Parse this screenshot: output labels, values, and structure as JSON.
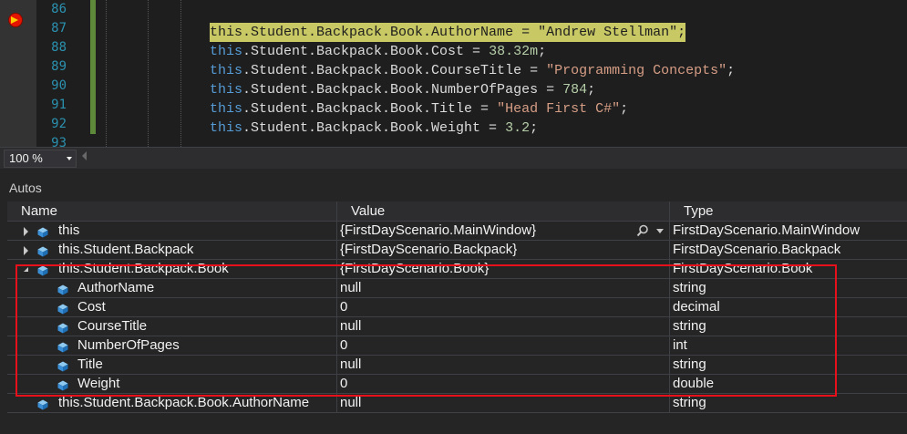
{
  "editor": {
    "line_numbers": [
      "86",
      "87",
      "88",
      "89",
      "90",
      "91",
      "92",
      "93"
    ],
    "lines": [
      {
        "kw": "",
        "rest": "",
        "value": "",
        "value_kind": "",
        "end": ""
      },
      {
        "kw": "this",
        "rest": ".Student.Backpack.Book.AuthorName = ",
        "value": "\"Andrew Stellman\"",
        "value_kind": "str",
        "end": ";"
      },
      {
        "kw": "this",
        "rest": ".Student.Backpack.Book.Cost = ",
        "value": "38.32m",
        "value_kind": "num",
        "end": ";"
      },
      {
        "kw": "this",
        "rest": ".Student.Backpack.Book.CourseTitle = ",
        "value": "\"Programming Concepts\"",
        "value_kind": "str",
        "end": ";"
      },
      {
        "kw": "this",
        "rest": ".Student.Backpack.Book.NumberOfPages = ",
        "value": "784",
        "value_kind": "num",
        "end": ";"
      },
      {
        "kw": "this",
        "rest": ".Student.Backpack.Book.Title = ",
        "value": "\"Head First C#\"",
        "value_kind": "str",
        "end": ";"
      },
      {
        "kw": "this",
        "rest": ".Student.Backpack.Book.Weight = ",
        "value": "3.2",
        "value_kind": "num",
        "end": ";"
      },
      {
        "kw": "",
        "rest": "",
        "value": "",
        "value_kind": "",
        "end": ""
      }
    ],
    "current_line": "87"
  },
  "zoom": {
    "value": "100 %"
  },
  "autos": {
    "title": "Autos",
    "columns": {
      "name": "Name",
      "value": "Value",
      "type": "Type"
    },
    "rows": [
      {
        "indent": 0,
        "expander": "collapsed",
        "name": "this",
        "value": "{FirstDayScenario.MainWindow}",
        "type": "FirstDayScenario.MainWindow",
        "search": true
      },
      {
        "indent": 0,
        "expander": "collapsed",
        "name": "this.Student.Backpack",
        "value": "{FirstDayScenario.Backpack}",
        "type": "FirstDayScenario.Backpack",
        "search": false
      },
      {
        "indent": 0,
        "expander": "expanded",
        "name": "this.Student.Backpack.Book",
        "value": "{FirstDayScenario.Book}",
        "type": "FirstDayScenario.Book",
        "search": false
      },
      {
        "indent": 1,
        "expander": "none",
        "name": "AuthorName",
        "value": "null",
        "type": "string",
        "search": false
      },
      {
        "indent": 1,
        "expander": "none",
        "name": "Cost",
        "value": "0",
        "type": "decimal",
        "search": false
      },
      {
        "indent": 1,
        "expander": "none",
        "name": "CourseTitle",
        "value": "null",
        "type": "string",
        "search": false
      },
      {
        "indent": 1,
        "expander": "none",
        "name": "NumberOfPages",
        "value": "0",
        "type": "int",
        "search": false
      },
      {
        "indent": 1,
        "expander": "none",
        "name": "Title",
        "value": "null",
        "type": "string",
        "search": false
      },
      {
        "indent": 1,
        "expander": "none",
        "name": "Weight",
        "value": "0",
        "type": "double",
        "search": false
      },
      {
        "indent": 0,
        "expander": "none",
        "name": "this.Student.Backpack.Book.AuthorName",
        "value": "null",
        "type": "string",
        "search": false
      }
    ]
  },
  "colors": {
    "highlight_box": "#e8101a",
    "current_line": "#c8c864",
    "breakpoint": "#e51400"
  },
  "icons": {
    "member": "cube-icon",
    "breakpoint": "breakpoint-arrow-icon",
    "search": "magnifier-icon"
  }
}
